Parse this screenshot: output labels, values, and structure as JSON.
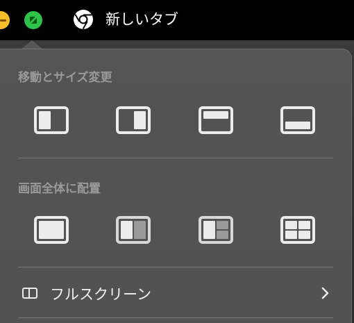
{
  "window": {
    "tab_title": "新しいタブ"
  },
  "menu": {
    "section_move_resize": "移動とサイズ変更",
    "section_fill_arrange": "画面全体に配置",
    "fullscreen_label": "フルスクリーン"
  },
  "colors": {
    "minimize": "#f5bf2b",
    "zoom": "#2fc24a",
    "panel_bg": "#585858",
    "section_title": "#9a9a9a",
    "icon": "#ececec"
  },
  "icons": {
    "chrome": "chrome-icon",
    "fullscreen": "sidebar-split-icon",
    "chevron": "chevron-right-icon"
  }
}
